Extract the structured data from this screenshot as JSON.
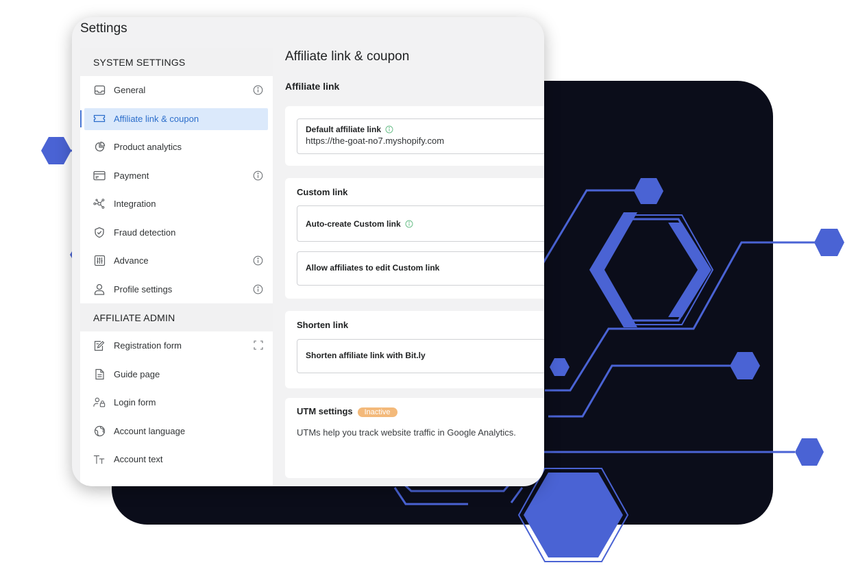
{
  "window": {
    "title": "Settings"
  },
  "sidebar": {
    "sections": [
      {
        "heading": "SYSTEM SETTINGS",
        "items": [
          {
            "label": "General",
            "icon": "inbox-icon",
            "info": true,
            "active": false
          },
          {
            "label": "Affiliate link & coupon",
            "icon": "ticket-icon",
            "info": false,
            "active": true
          },
          {
            "label": "Product analytics",
            "icon": "pie-chart-icon",
            "info": false,
            "active": false
          },
          {
            "label": "Payment",
            "icon": "credit-card-icon",
            "info": true,
            "active": false
          },
          {
            "label": "Integration",
            "icon": "network-icon",
            "info": false,
            "active": false
          },
          {
            "label": "Fraud detection",
            "icon": "shield-check-icon",
            "info": false,
            "active": false
          },
          {
            "label": "Advance",
            "icon": "sliders-icon",
            "info": true,
            "active": false
          },
          {
            "label": "Profile settings",
            "icon": "user-icon",
            "info": true,
            "active": false
          }
        ]
      },
      {
        "heading": "AFFILIATE ADMIN",
        "items": [
          {
            "label": "Registration form",
            "icon": "form-edit-icon",
            "expand": true
          },
          {
            "label": "Guide page",
            "icon": "document-icon"
          },
          {
            "label": "Login form",
            "icon": "user-lock-icon"
          },
          {
            "label": "Account language",
            "icon": "globe-icon"
          },
          {
            "label": "Account text",
            "icon": "text-size-icon"
          }
        ]
      }
    ]
  },
  "main": {
    "title": "Affiliate link & coupon",
    "affiliate_link_heading": "Affiliate link",
    "default_link": {
      "label": "Default affiliate link",
      "value": "https://the-goat-no7.myshopify.com"
    },
    "custom_link": {
      "title": "Custom link",
      "auto_create_label": "Auto-create Custom link",
      "allow_edit_label": "Allow affiliates to edit Custom link"
    },
    "shorten_link": {
      "title": "Shorten link",
      "bitly_label": "Shorten affiliate link with Bit.ly"
    },
    "utm": {
      "title": "UTM settings",
      "status": "Inactive",
      "description": "UTMs help you track website traffic in Google Analytics."
    }
  },
  "colors": {
    "accent": "#2c6ecb",
    "active_bg": "#dbe9fb",
    "dark_panel": "#0b0d1a",
    "decor_blue": "#4a63d4",
    "badge_bg": "#f3b97a"
  }
}
